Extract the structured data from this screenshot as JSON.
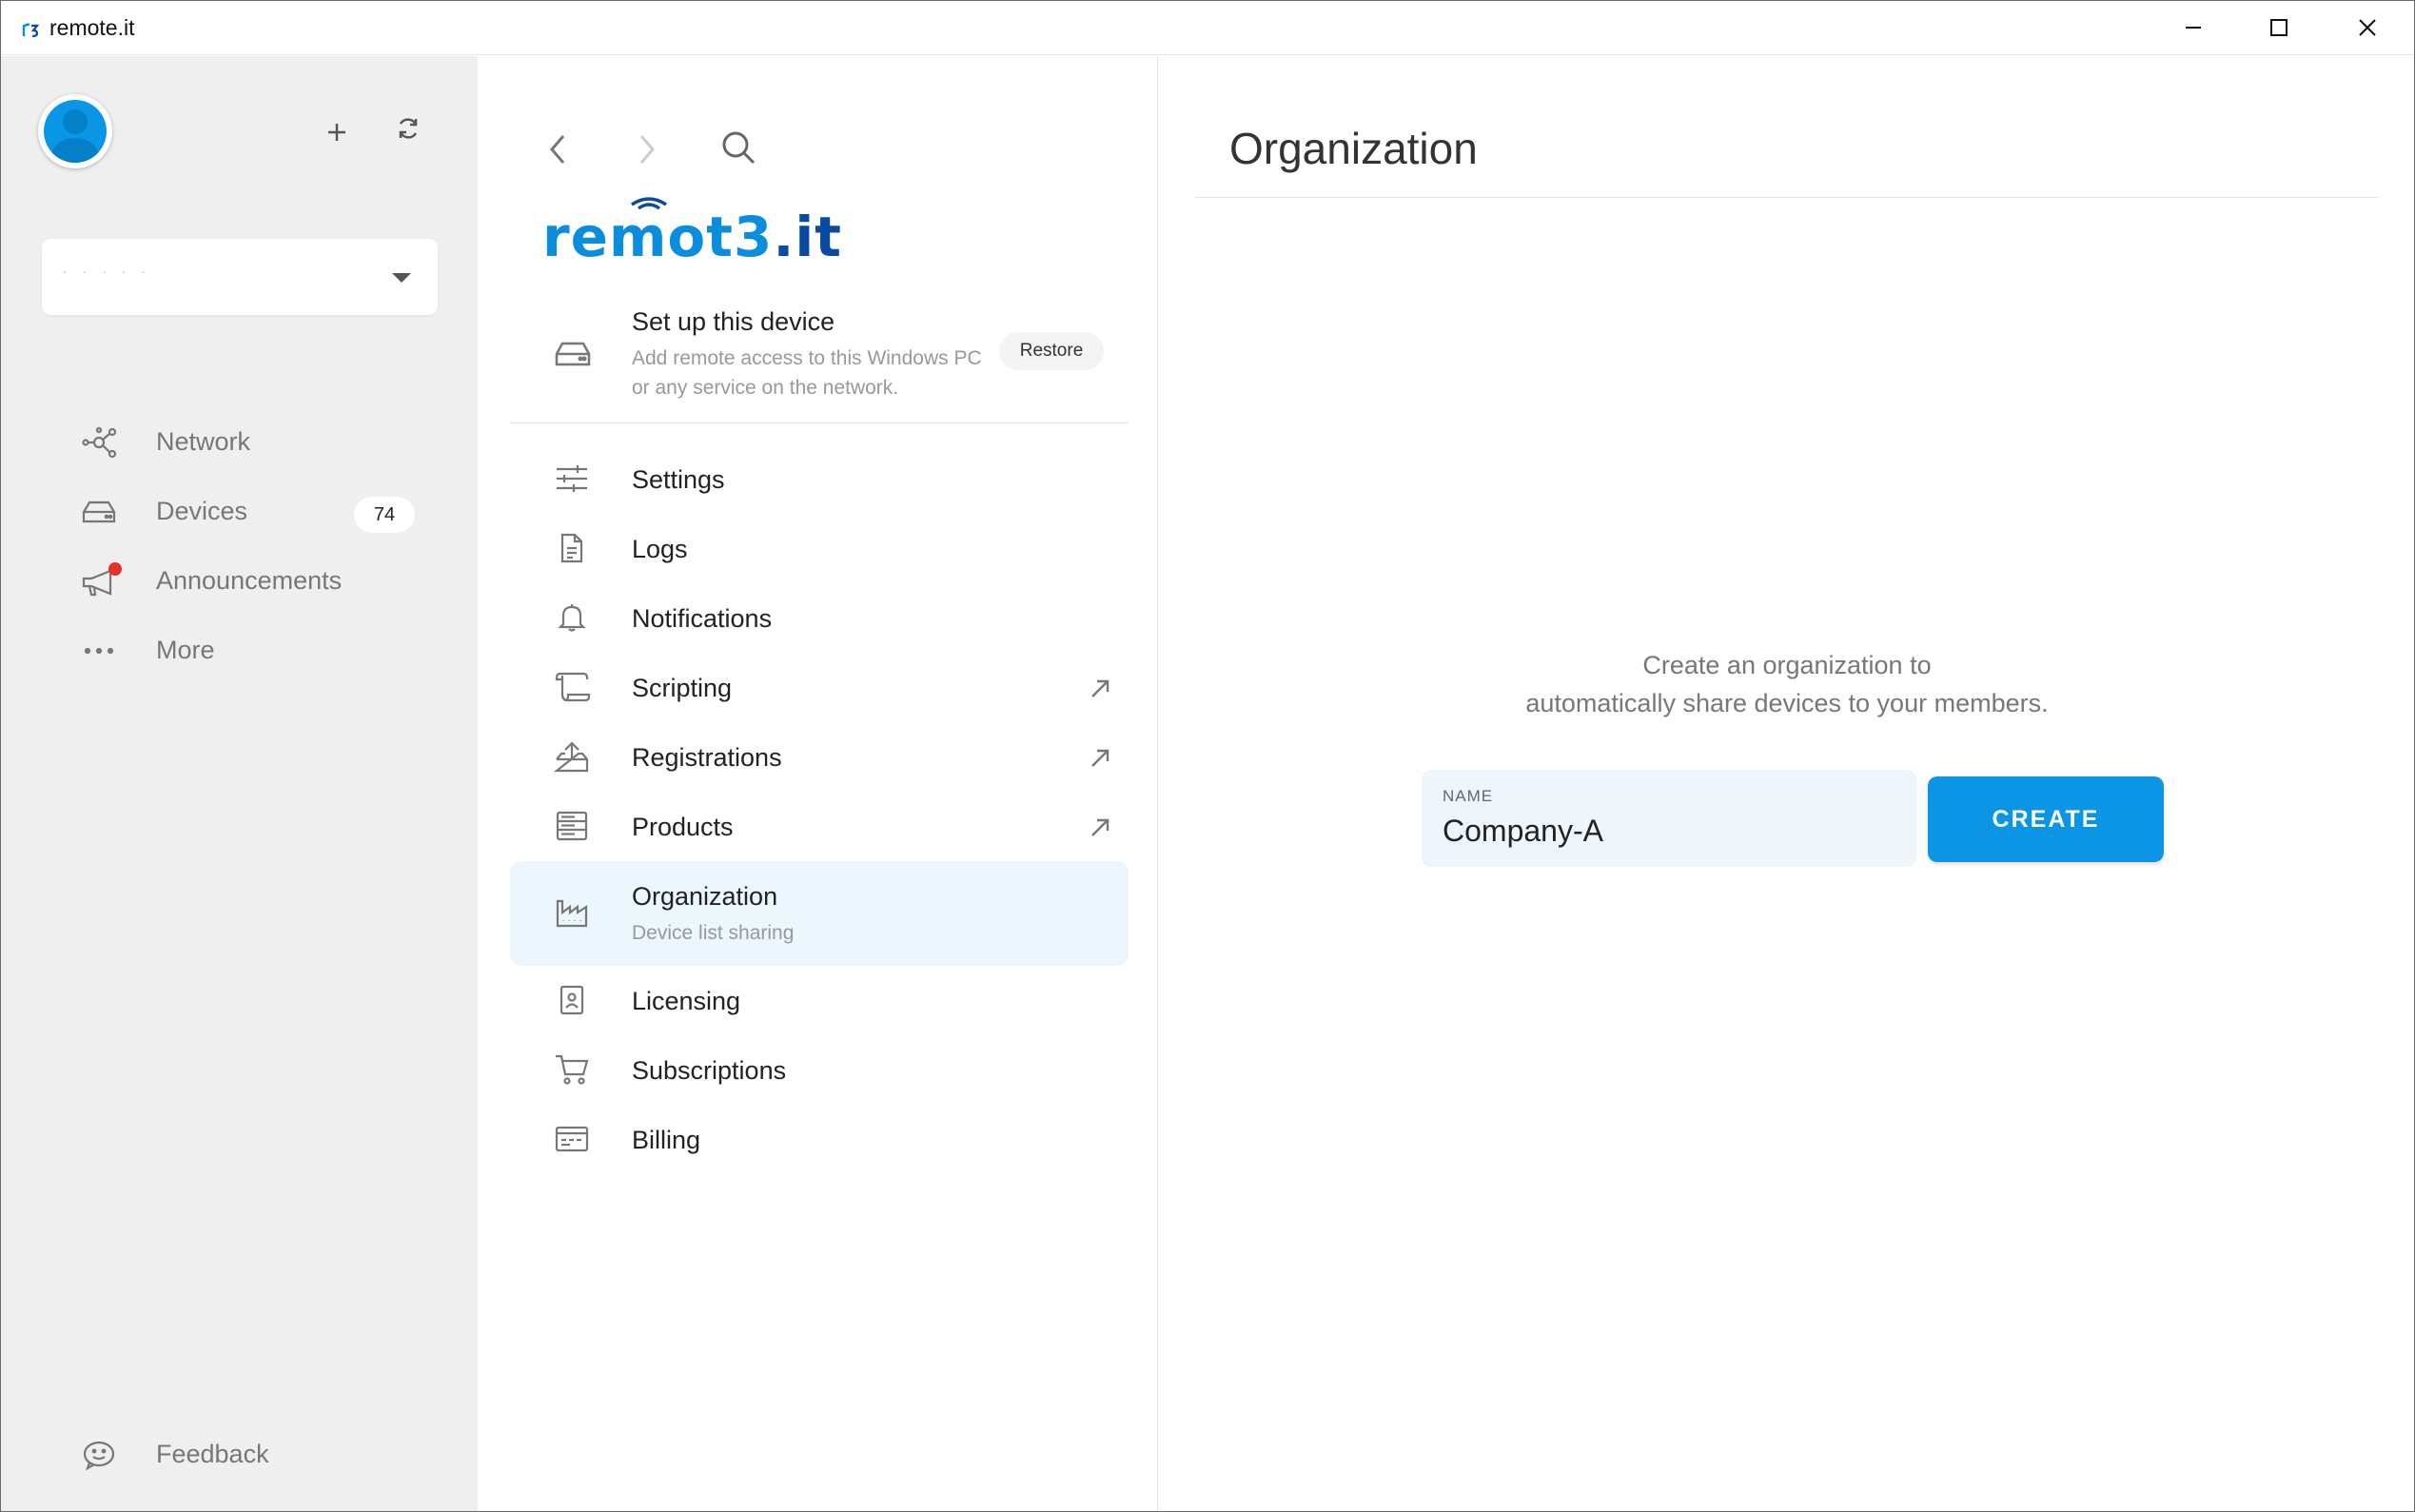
{
  "window": {
    "title": "remote.it",
    "app_icon": "remoteit-app-icon",
    "controls": [
      "minimize-icon",
      "maximize-icon",
      "close-icon"
    ]
  },
  "rail": {
    "account_value": "· · · · ·",
    "nav": [
      {
        "label": "Network",
        "icon": "network-icon"
      },
      {
        "label": "Devices",
        "icon": "devices-icon",
        "badge": "74"
      },
      {
        "label": "Announcements",
        "icon": "megaphone-icon",
        "has_notification_dot": true
      },
      {
        "label": "More",
        "icon": "more-icon"
      }
    ],
    "feedback_label": "Feedback"
  },
  "middle": {
    "logo": {
      "part1": "remot",
      "part2": "3",
      "part3": ".it"
    },
    "setup": {
      "title": "Set up this device",
      "subtitle": "Add remote access to this Windows PC or any service on the network.",
      "restore_label": "Restore"
    },
    "menu": [
      {
        "label": "Settings",
        "icon": "sliders-icon"
      },
      {
        "label": "Logs",
        "icon": "document-icon"
      },
      {
        "label": "Notifications",
        "icon": "bell-icon"
      },
      {
        "label": "Scripting",
        "icon": "scroll-icon",
        "external": true
      },
      {
        "label": "Registrations",
        "icon": "upload-tray-icon",
        "external": true
      },
      {
        "label": "Products",
        "icon": "server-rack-icon",
        "external": true
      },
      {
        "label": "Organization",
        "icon": "industry-icon",
        "subtitle": "Device list sharing",
        "active": true
      },
      {
        "label": "Licensing",
        "icon": "id-badge-icon"
      },
      {
        "label": "Subscriptions",
        "icon": "cart-icon"
      },
      {
        "label": "Billing",
        "icon": "credit-card-icon"
      }
    ]
  },
  "main": {
    "title": "Organization",
    "description_line1": "Create an organization to",
    "description_line2": "automatically share devices to your members.",
    "name_label": "NAME",
    "name_value": "Company-A",
    "create_label": "CREATE"
  },
  "colors": {
    "accent": "#0b95e4",
    "active_bg": "#ebf6fd",
    "rail_bg": "#efefef",
    "notification": "#e3322b"
  }
}
